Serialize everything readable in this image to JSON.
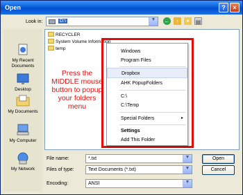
{
  "window": {
    "title": "Open",
    "help_glyph": "?",
    "close_glyph": "×"
  },
  "lookin": {
    "label": "Look in:",
    "value": "D:\\"
  },
  "places": [
    {
      "label": "My Recent Documents",
      "icon": "recent-documents-icon"
    },
    {
      "label": "Desktop",
      "icon": "desktop-icon"
    },
    {
      "label": "My Documents",
      "icon": "my-documents-icon"
    },
    {
      "label": "My Computer",
      "icon": "my-computer-icon"
    },
    {
      "label": "My Network",
      "icon": "my-network-icon"
    }
  ],
  "files": [
    "RECYCLER",
    "System Volume Information",
    "temp"
  ],
  "annotation": "Press the MIDDLE mouse button to popup your folders menu",
  "menu": {
    "items": [
      "Windows",
      "Program Files",
      "Dropbox",
      "AHK PopupFolders",
      "C:\\",
      "C:\\Temp",
      "Special Folders",
      "Settings",
      "Add This Folder"
    ],
    "submenu_arrow": "▸"
  },
  "filename": {
    "label": "File name:",
    "value": "*.txt"
  },
  "filetype": {
    "label": "Files of type:",
    "value": "Text Documents (*.txt)"
  },
  "encoding": {
    "label": "Encoding:",
    "value": "ANSI"
  },
  "buttons": {
    "open": "Open",
    "cancel": "Cancel"
  },
  "colors": {
    "annotation": "#e01010",
    "frame": "#e10d0d",
    "title_bar": "#0a5fd8"
  }
}
